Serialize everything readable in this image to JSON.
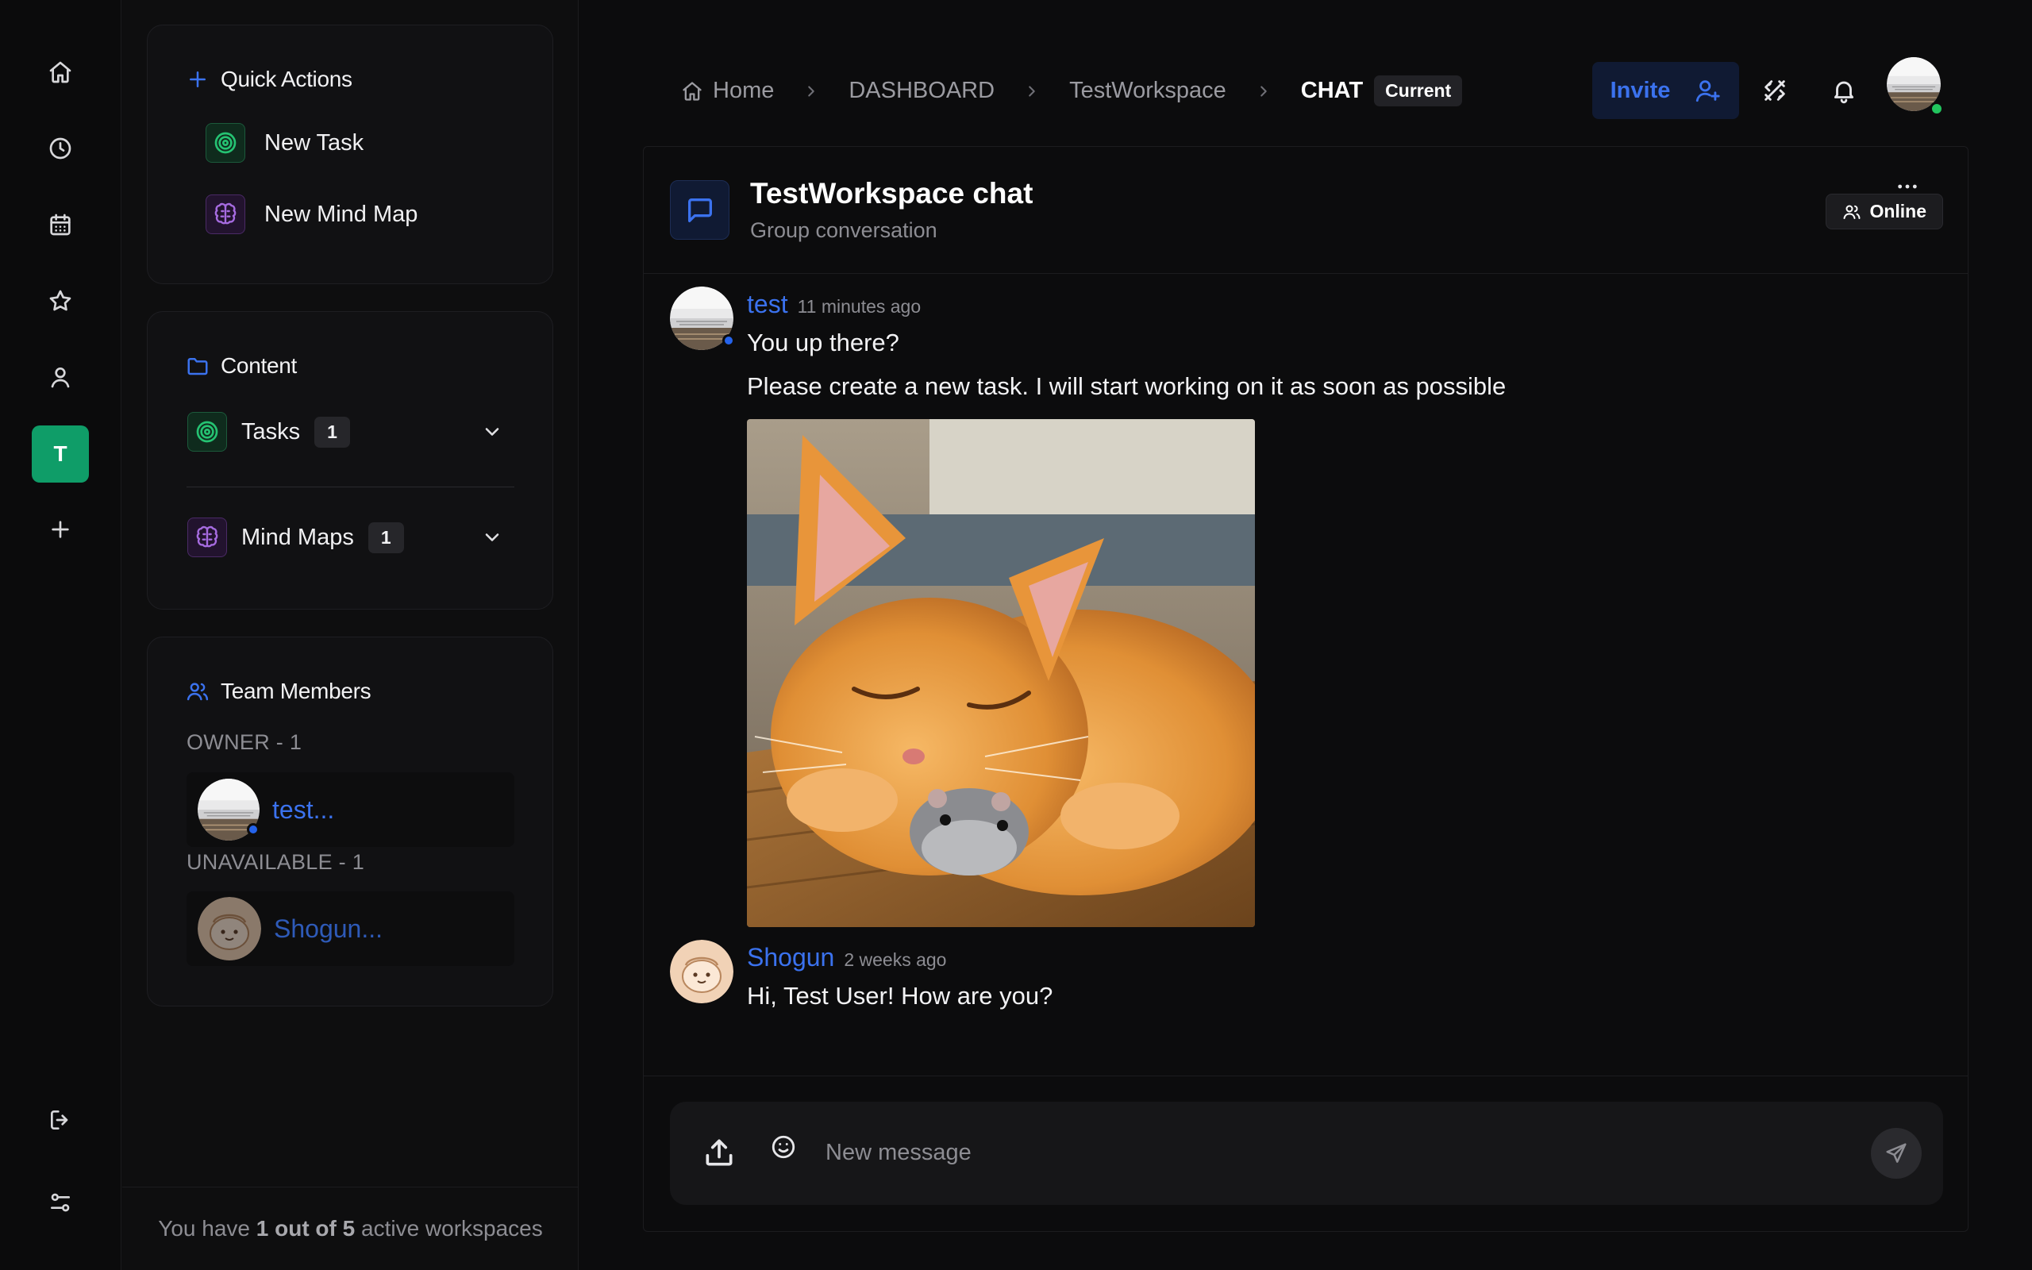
{
  "rail": {
    "workspace_initial": "T",
    "icons": [
      "home-icon",
      "clock-icon",
      "calendar-icon",
      "star-icon",
      "user-icon",
      "plus-icon",
      "logout-icon",
      "settings-sliders-icon"
    ]
  },
  "sidebar": {
    "quick_actions": {
      "title": "Quick Actions",
      "new_task": "New Task",
      "new_mind_map": "New Mind Map"
    },
    "content": {
      "title": "Content",
      "tasks_label": "Tasks",
      "tasks_count": "1",
      "mindmaps_label": "Mind Maps",
      "mindmaps_count": "1"
    },
    "team": {
      "title": "Team Members",
      "owner_group": "OWNER - 1",
      "owner_name": "test...",
      "unavailable_group": "UNAVAILABLE - 1",
      "unavailable_name": "Shogun..."
    },
    "footer": {
      "prefix": "You have",
      "bold": "1 out of 5",
      "suffix": "active workspaces"
    }
  },
  "header": {
    "breadcrumb": {
      "home": "Home",
      "dashboard": "DASHBOARD",
      "workspace": "TestWorkspace",
      "current": "CHAT",
      "current_badge": "Current"
    },
    "invite_label": "Invite"
  },
  "chat": {
    "title": "TestWorkspace chat",
    "subtitle": "Group conversation",
    "status": "Online",
    "messages": [
      {
        "author": "test",
        "time": "11 minutes ago",
        "lines": [
          "You up there?",
          "Please create a new task. I will start working on it as soon as possible"
        ],
        "image": "sleeping-orange-cat-with-hamster"
      },
      {
        "author": "Shogun",
        "time": "2 weeks ago",
        "lines": [
          "Hi, Test User! How are you?"
        ]
      }
    ],
    "composer_placeholder": "New message"
  },
  "colors": {
    "accent": "#3b72ee",
    "workspace": "#0f9d68",
    "online": "#22c55e",
    "background": "#0c0c0d"
  }
}
